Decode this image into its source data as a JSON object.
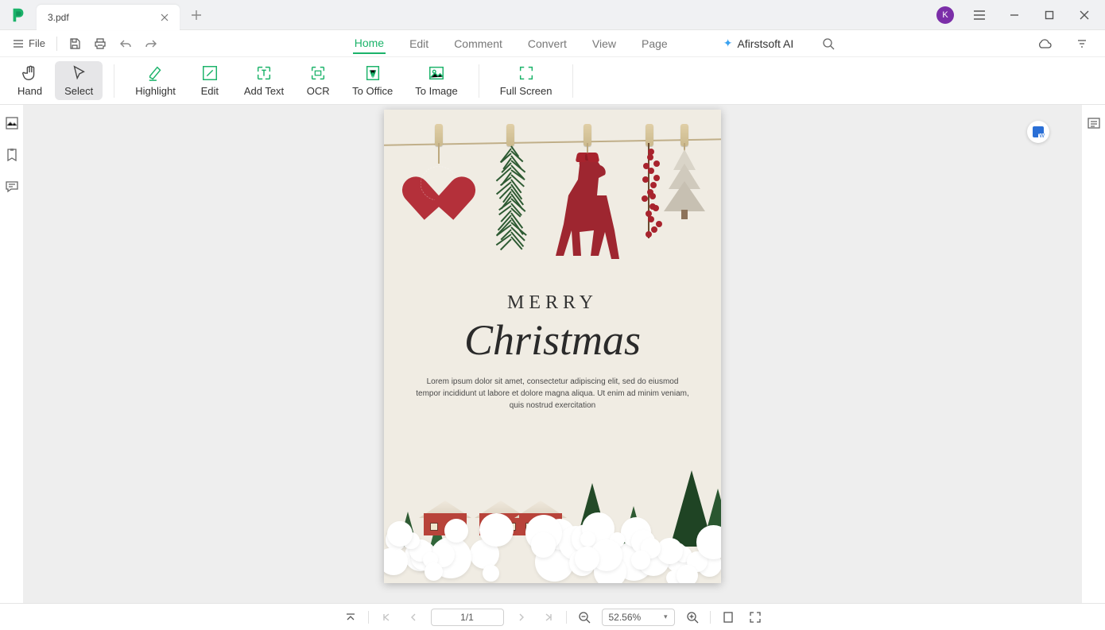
{
  "titlebar": {
    "tab_title": "3.pdf",
    "avatar_initial": "K"
  },
  "quickbar": {
    "file_label": "File"
  },
  "menu": {
    "items": [
      "Home",
      "Edit",
      "Comment",
      "Convert",
      "View",
      "Page"
    ],
    "active_index": 0,
    "ai_label": "Afirstsoft AI"
  },
  "ribbon": {
    "hand": "Hand",
    "select": "Select",
    "highlight": "Highlight",
    "edit": "Edit",
    "add_text": "Add Text",
    "ocr": "OCR",
    "to_office": "To Office",
    "to_image": "To Image",
    "full_screen": "Full Screen"
  },
  "document": {
    "merry": "MERRY",
    "christmas": "Christmas",
    "lorem": "Lorem ipsum dolor sit amet, consectetur adipiscing elit, sed do eiusmod tempor incididunt ut labore et dolore magna aliqua. Ut enim ad minim veniam, quis nostrud exercitation"
  },
  "statusbar": {
    "page_indicator": "1/1",
    "zoom_value": "52.56%"
  }
}
